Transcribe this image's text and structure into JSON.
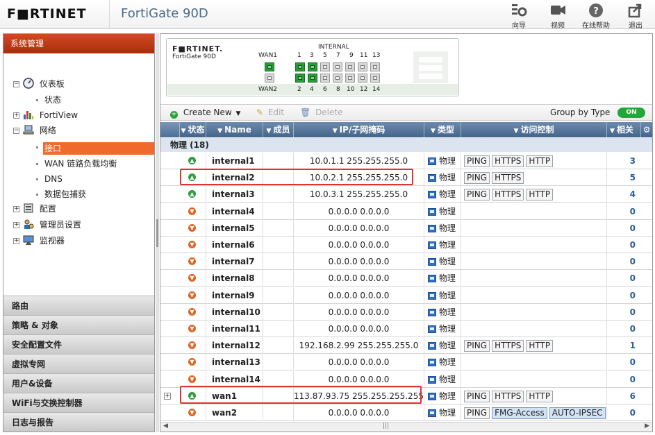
{
  "header": {
    "brand": "F■RTINET",
    "model": "FortiGate 90D",
    "tools": [
      {
        "icon": "wizard-icon",
        "label": "向导"
      },
      {
        "icon": "video-icon",
        "label": "视频"
      },
      {
        "icon": "help-icon",
        "label": "在线帮助"
      },
      {
        "icon": "logout-icon",
        "label": "退出"
      }
    ]
  },
  "sidebar": {
    "title": "系统管理",
    "tree": [
      {
        "label": "仪表板",
        "icon": "dashboard-icon"
      },
      {
        "label": "状态"
      },
      {
        "label": "FortiView",
        "icon": "fortiview-icon"
      },
      {
        "label": "网络",
        "icon": "network-icon"
      },
      {
        "label": "接口",
        "selected": true
      },
      {
        "label": "WAN 链路负载均衡"
      },
      {
        "label": "DNS"
      },
      {
        "label": "数据包捕获"
      },
      {
        "label": "配置",
        "icon": "config-icon"
      },
      {
        "label": "管理员设置",
        "icon": "admin-icon"
      },
      {
        "label": "监视器",
        "icon": "monitor-icon"
      }
    ],
    "sections": [
      "路由",
      "策略 & 对象",
      "安全配置文件",
      "虚拟专网",
      "用户&设备",
      "WiFi与交换控制器",
      "日志与报告"
    ]
  },
  "device": {
    "logo": "F■RTINET.",
    "model": "FortiGate 90D",
    "internal_label": "INTERNAL",
    "wan1_label": "WAN1",
    "wan2_label": "WAN2",
    "top_port_numbers": [
      "1",
      "3",
      "5",
      "7",
      "9",
      "11",
      "13"
    ],
    "bottom_port_numbers": [
      "2",
      "4",
      "6",
      "8",
      "10",
      "12",
      "14"
    ]
  },
  "toolbar": {
    "create_new": "Create New",
    "edit": "Edit",
    "delete": "Delete",
    "group_by": "Group by Type",
    "toggle": "ON"
  },
  "table": {
    "columns": [
      "状态",
      "Name",
      "成员",
      "IP/子网掩码",
      "类型",
      "访问控制",
      "相关"
    ],
    "group_label": "物理 (18)",
    "rows": [
      {
        "status": "up",
        "name": "internal1",
        "ip": "10.0.1.1 255.255.255.0",
        "type": "物理",
        "access": [
          "PING",
          "HTTPS",
          "HTTP"
        ],
        "ref": "3"
      },
      {
        "status": "up",
        "name": "internal2",
        "ip": "10.0.2.1 255.255.255.0",
        "type": "物理",
        "access": [
          "PING",
          "HTTPS"
        ],
        "ref": "5"
      },
      {
        "status": "up",
        "name": "internal3",
        "ip": "10.0.3.1 255.255.255.0",
        "type": "物理",
        "access": [
          "PING",
          "HTTPS",
          "HTTP"
        ],
        "ref": "4"
      },
      {
        "status": "down",
        "name": "internal4",
        "ip": "0.0.0.0 0.0.0.0",
        "type": "物理",
        "access": [],
        "ref": "0"
      },
      {
        "status": "down",
        "name": "internal5",
        "ip": "0.0.0.0 0.0.0.0",
        "type": "物理",
        "access": [],
        "ref": "0"
      },
      {
        "status": "down",
        "name": "internal6",
        "ip": "0.0.0.0 0.0.0.0",
        "type": "物理",
        "access": [],
        "ref": "0"
      },
      {
        "status": "down",
        "name": "internal7",
        "ip": "0.0.0.0 0.0.0.0",
        "type": "物理",
        "access": [],
        "ref": "0"
      },
      {
        "status": "down",
        "name": "internal8",
        "ip": "0.0.0.0 0.0.0.0",
        "type": "物理",
        "access": [],
        "ref": "0"
      },
      {
        "status": "down",
        "name": "internal9",
        "ip": "0.0.0.0 0.0.0.0",
        "type": "物理",
        "access": [],
        "ref": "0"
      },
      {
        "status": "down",
        "name": "internal10",
        "ip": "0.0.0.0 0.0.0.0",
        "type": "物理",
        "access": [],
        "ref": "0"
      },
      {
        "status": "down",
        "name": "internal11",
        "ip": "0.0.0.0 0.0.0.0",
        "type": "物理",
        "access": [],
        "ref": "0"
      },
      {
        "status": "down",
        "name": "internal12",
        "ip": "192.168.2.99 255.255.255.0",
        "type": "物理",
        "access": [
          "PING",
          "HTTPS",
          "HTTP"
        ],
        "ref": "1"
      },
      {
        "status": "down",
        "name": "internal13",
        "ip": "0.0.0.0 0.0.0.0",
        "type": "物理",
        "access": [],
        "ref": "0"
      },
      {
        "status": "down",
        "name": "internal14",
        "ip": "0.0.0.0 0.0.0.0",
        "type": "物理",
        "access": [],
        "ref": "0"
      },
      {
        "status": "up",
        "name": "wan1",
        "ip": "113.87.93.75 255.255.255.255",
        "type": "物理",
        "access": [
          "PING",
          "HTTPS",
          "HTTP"
        ],
        "ref": "6"
      },
      {
        "status": "down",
        "name": "wan2",
        "ip": "0.0.0.0 0.0.0.0",
        "type": "物理",
        "access": [
          "PING",
          "FMG-Access",
          "AUTO-IPSEC"
        ],
        "ref": "0"
      }
    ]
  },
  "colors": {
    "accent": "#c23b17",
    "header_blue": "#4e6f96",
    "up": "#2e9d3e",
    "down": "#e0641f",
    "highlight": "#dd3333"
  }
}
